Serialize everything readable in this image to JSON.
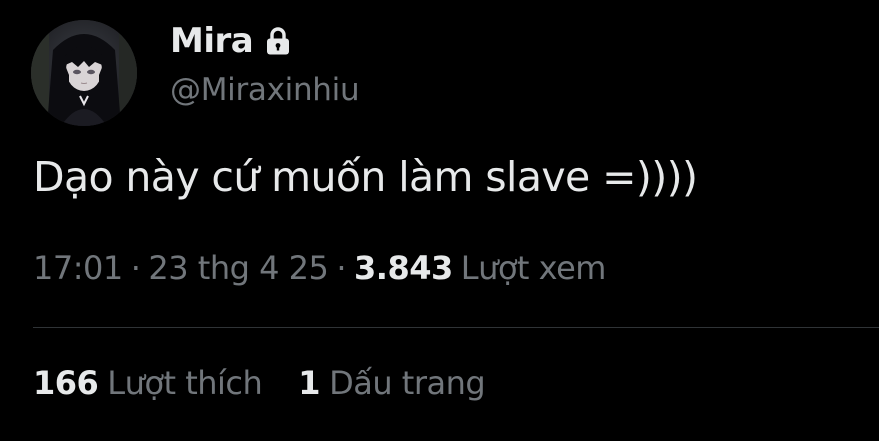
{
  "author": {
    "display_name": "Mira",
    "handle": "@Miraxinhiu",
    "protected_icon": "lock-icon"
  },
  "tweet": {
    "text": "Dạo này cứ muốn làm slave =))))"
  },
  "meta": {
    "time": "17:01",
    "separator_1": "·",
    "date": "23 thg 4 25",
    "separator_2": "·",
    "views_count": "3.843",
    "views_label": "Lượt xem"
  },
  "stats": {
    "likes_count": "166",
    "likes_label": "Lượt thích",
    "bookmarks_count": "1",
    "bookmarks_label": "Dấu trang"
  },
  "colors": {
    "background": "#000000",
    "primary_text": "#e7e9ea",
    "secondary_text": "#71767b",
    "divider": "#2f3336"
  }
}
